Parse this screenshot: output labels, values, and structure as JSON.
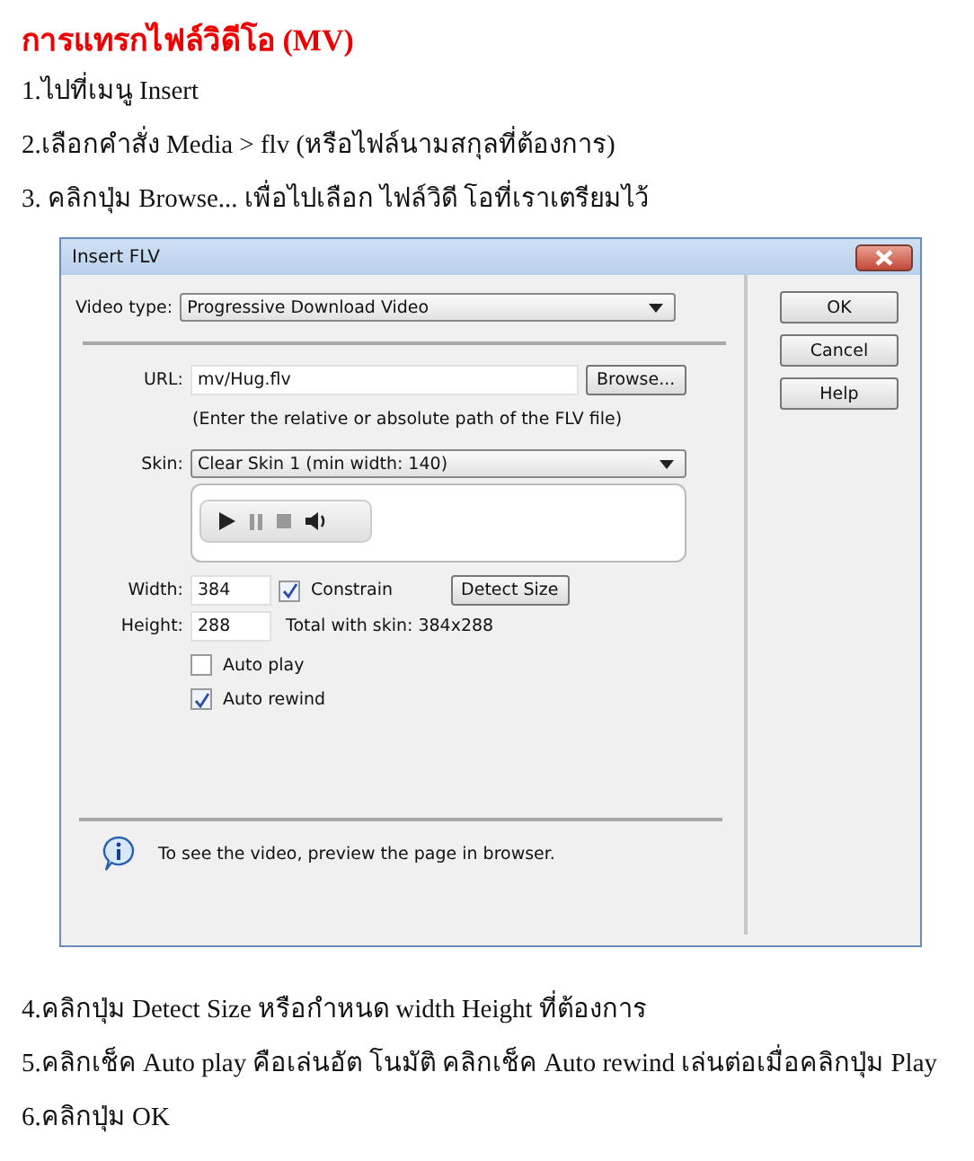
{
  "heading": "การแทรกไฟล์วิดีโอ (MV)",
  "steps_before": [
    "1.ไปที่เมนู Insert",
    "2.เลือกคำสั่ง Media > flv  (หรือไฟล์นามสกุลที่ต้องการ)",
    "3. คลิกปุ่ม Browse... เพื่อไปเลือก ไฟล์วิดี โอที่เราเตรียมไว้"
  ],
  "dialog": {
    "title": "Insert FLV",
    "video_type": {
      "label": "Video type:",
      "value": "Progressive Download Video"
    },
    "url": {
      "label": "URL:",
      "value": "mv/Hug.flv",
      "button": "Browse...",
      "hint": "(Enter the relative or absolute path of the FLV file)"
    },
    "skin": {
      "label": "Skin:",
      "value": "Clear Skin 1 (min width: 140)"
    },
    "width": {
      "label": "Width:",
      "value": "384"
    },
    "height": {
      "label": "Height:",
      "value": "288"
    },
    "constrain": {
      "label": "Constrain",
      "checked": true
    },
    "detect_button": "Detect Size",
    "total": "Total with skin: 384x288",
    "options": [
      {
        "label": "Auto play",
        "checked": false
      },
      {
        "label": "Auto rewind",
        "checked": true
      }
    ],
    "info": "To see the video, preview the page in browser.",
    "buttons": [
      "OK",
      "Cancel",
      "Help"
    ]
  },
  "steps_after": [
    "4.คลิกปุ่ม  Detect Size หรือกำหนด width Height ที่ต้องการ",
    "5.คลิกเช็ค Auto play คือเล่นอัต โนมัติ คลิกเช็ค Auto rewind เล่นต่อเมื่อคลิกปุ่ม Play",
    "6.คลิกปุ่ม OK"
  ]
}
